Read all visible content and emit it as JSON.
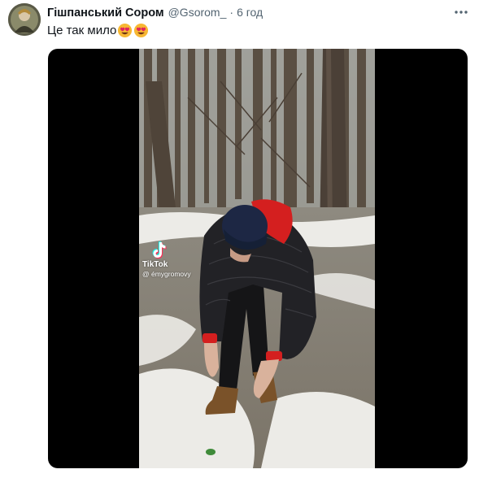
{
  "tweet": {
    "author_name": "Гішпанський Сором",
    "handle": "@Gsorom_",
    "separator": "·",
    "time": "6 год",
    "text": "Це так мило",
    "emojis": [
      "smiling-face-with-heart-eyes-icon",
      "smiling-face-with-heart-eyes-icon"
    ],
    "more_icon": "more-dots-icon"
  },
  "media": {
    "type": "video",
    "watermark": {
      "brand": "TikTok",
      "username": "@ émygromovy"
    }
  },
  "colors": {
    "text_primary": "#0f1419",
    "text_secondary": "#536471",
    "media_background": "#000000",
    "hoodie_red": "#d41f1f",
    "beanie_navy": "#1d2744"
  }
}
